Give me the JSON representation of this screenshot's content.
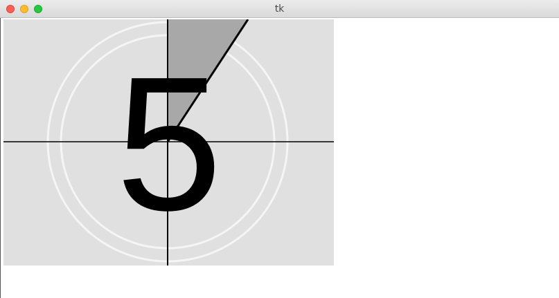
{
  "window": {
    "title": "tk"
  },
  "canvas": {
    "digit": "5",
    "colors": {
      "background": "#e0e0e0",
      "rings": "#f5f5f5",
      "sweep": "#a8a8a8",
      "lines": "#000000"
    },
    "traffic_lights": [
      "close-icon",
      "minimize-icon",
      "maximize-icon"
    ]
  }
}
